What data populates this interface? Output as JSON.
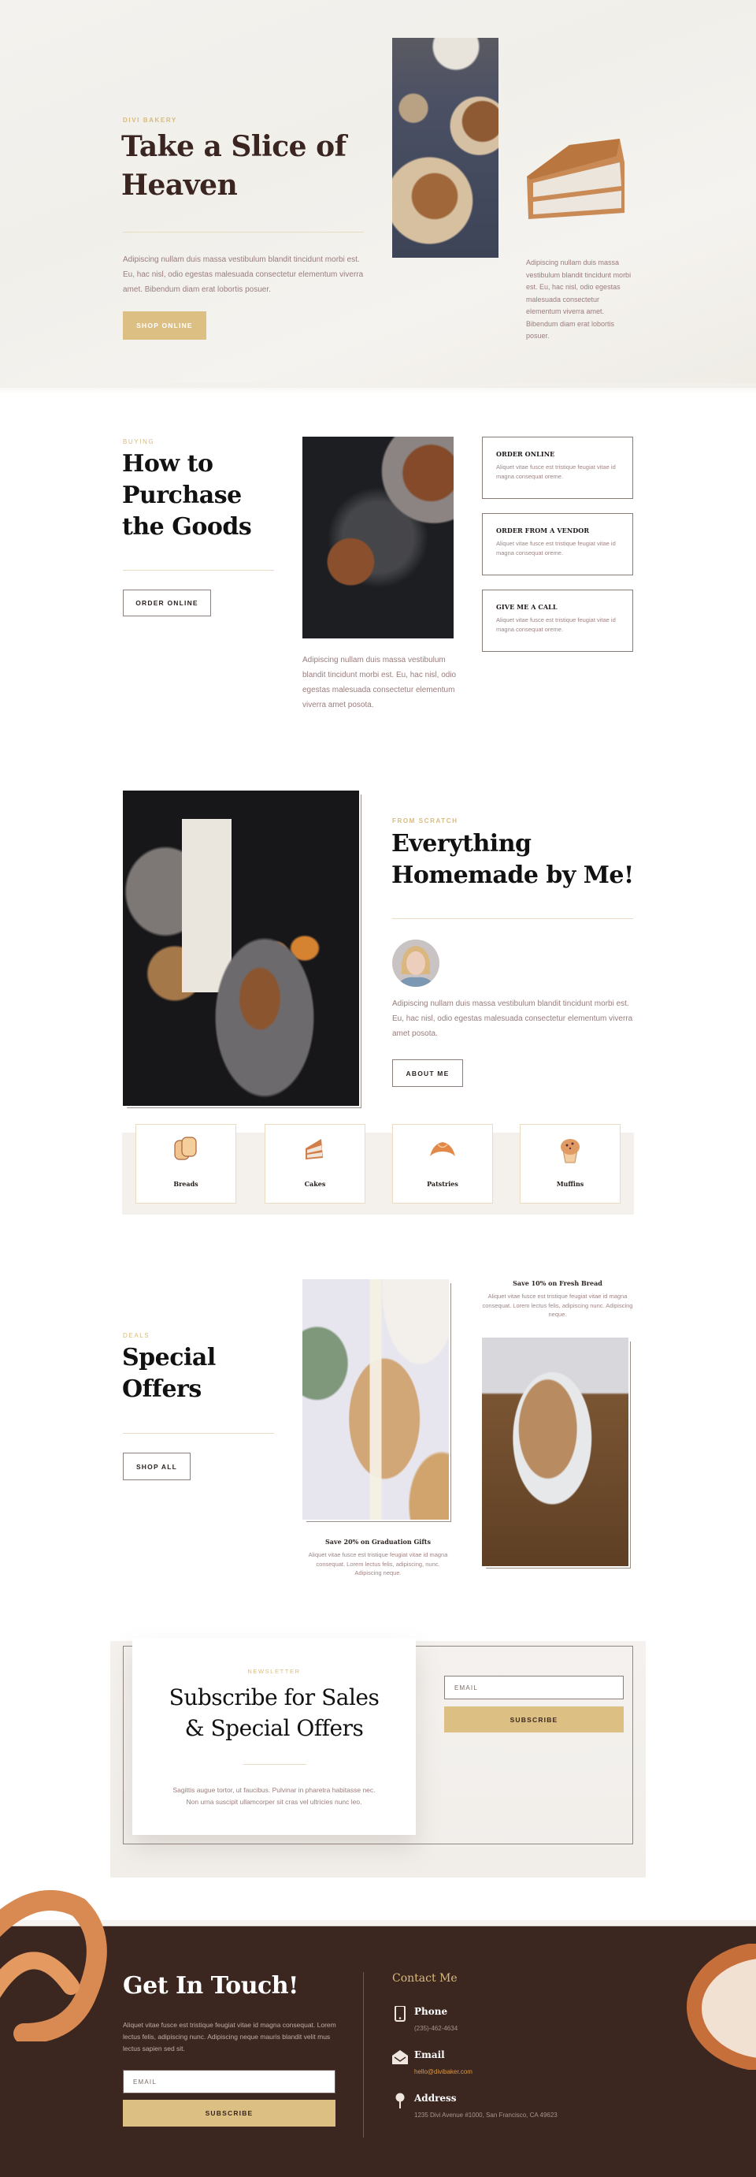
{
  "hero": {
    "eyebrow": "DIVI BAKERY",
    "title_line1": "Take a Slice of",
    "title_line2": "Heaven",
    "body": "Adipiscing nullam duis massa vestibulum blandit tincidunt morbi est. Eu, hac nisl, odio egestas malesuada consectetur elementum viverra amet. Bibendum diam erat lobortis posuer.",
    "cta_label": "SHOP ONLINE",
    "side_text": "Adipiscing nullam duis massa vestibulum blandit tincidunt morbi est. Eu, hac nisl, odio egestas malesuada consectetur elementum viverra amet. Bibendum diam erat lobortis posuer."
  },
  "buying": {
    "eyebrow": "BUYING",
    "title_line1": "How to",
    "title_line2": "Purchase",
    "title_line3": "the Goods",
    "cta_label": "ORDER ONLINE",
    "image_caption": "Adipiscing nullam duis massa vestibulum blandit tincidunt morbi est. Eu, hac nisl, odio egestas malesuada consectetur elementum viverra amet posota.",
    "options": [
      {
        "title": "ORDER ONLINE",
        "desc": "Aliquet vitae fusce est tristique feugiat vitae id magna consequat oreme."
      },
      {
        "title": "ORDER FROM A VENDOR",
        "desc": "Aliquet vitae fusce est tristique feugiat vitae id magna consequat oreme."
      },
      {
        "title": "GIVE ME A CALL",
        "desc": "Aliquet vitae fusce est tristique feugiat vitae id magna consequat oreme."
      }
    ]
  },
  "about": {
    "eyebrow": "FROM SCRATCH",
    "title_line1": "Everything",
    "title_line2": "Homemade by Me!",
    "body": "Adipiscing nullam duis massa vestibulum blandit tincidunt morbi est. Eu, hac nisl, odio egestas malesuada consectetur elementum viverra amet posota.",
    "cta_label": "ABOUT ME",
    "categories": [
      {
        "label": "Breads",
        "icon": "bread-icon"
      },
      {
        "label": "Cakes",
        "icon": "cake-slice-icon"
      },
      {
        "label": "Patstries",
        "icon": "croissant-icon"
      },
      {
        "label": "Muffins",
        "icon": "muffin-icon"
      }
    ]
  },
  "deals": {
    "eyebrow": "DEALS",
    "title_line1": "Special",
    "title_line2": "Offers",
    "cta_label": "SHOP ALL",
    "offers": [
      {
        "title": "Save 20% on Graduation Gifts",
        "desc": "Aliquet vitae fusce est tristique feugiat vitae id magna consequat. Lorem lectus felis, adipiscing, nunc. Adipiscing neque."
      },
      {
        "title": "Save 10% on Fresh Bread",
        "desc": "Aliquet vitae fusce est tristique feugiat vitae id magna consequat. Lorem lectus felis, adipiscing nunc. Adipiscing neque."
      }
    ]
  },
  "newsletter": {
    "eyebrow": "NEWSLETTER",
    "title_line1": "Subscribe for Sales",
    "title_line2": "& Special Offers",
    "body_line1": "Sagittis augue tortor, ut faucibus. Pulvinar in pharetra habitasse nec.",
    "body_line2": "Non urna suscipit ullamcorper sit cras vel ultricies nunc leo.",
    "email_placeholder": "EMAIL",
    "email_value": "",
    "subscribe_label": "SUBSCRIBE"
  },
  "footer": {
    "title": "Get In Touch!",
    "body": "Aliquet vitae fusce est tristique feugiat vitae id magna consequat. Lorem lectus felis, adipiscing nunc. Adipiscing neque mauris blandit velit mus lectus sapien sed sit.",
    "email_placeholder": "EMAIL",
    "email_value": "",
    "subscribe_label": "SUBSCRIBE",
    "contact_heading": "Contact Me",
    "contacts": [
      {
        "label": "Phone",
        "value": "(235)-462-4634",
        "icon": "phone-icon"
      },
      {
        "label": "Email",
        "value": "hello@divibaker.com",
        "icon": "envelope-icon"
      },
      {
        "label": "Address",
        "value": "1235 Divi Avenue #1000, San Francisco, CA 49623",
        "icon": "map-pin-icon"
      }
    ]
  },
  "colors": {
    "gold_accent": "#dcbf82",
    "eyebrow_gold": "#d8bb7e",
    "dark_brown": "#3c2620",
    "heading_brown": "#3a2520",
    "body_mauve": "#9a7c7c",
    "email_link": "#d99a48"
  }
}
